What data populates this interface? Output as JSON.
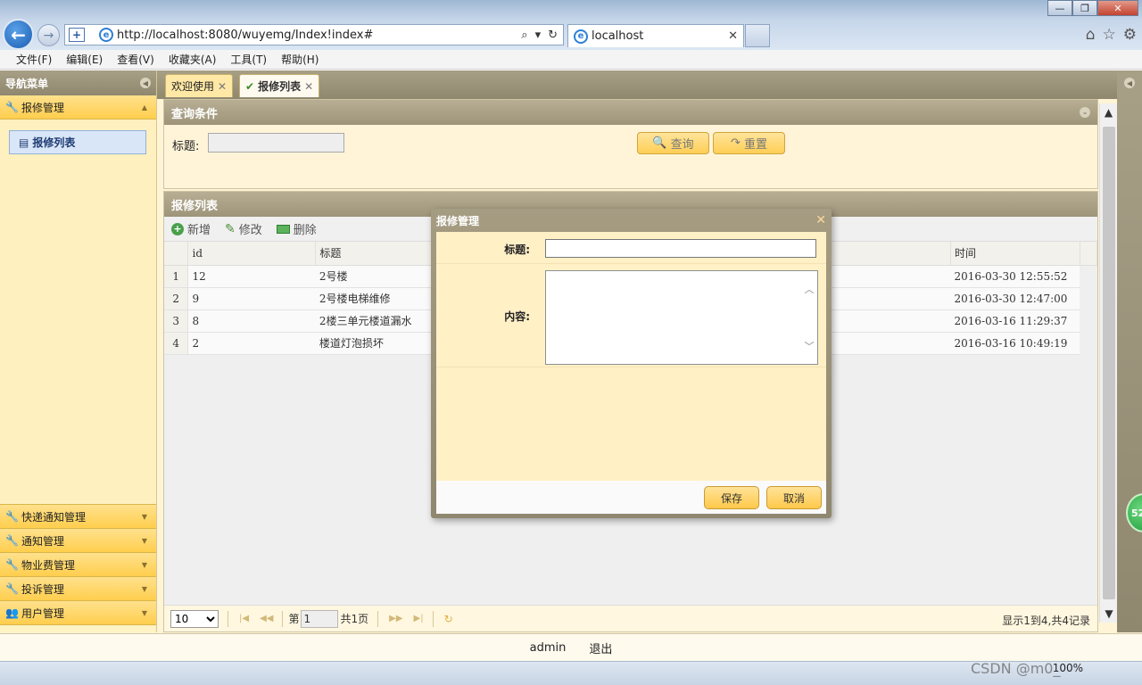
{
  "browser": {
    "url": "http://localhost:8080/wuyemg/Index!index#",
    "tab_title": "localhost",
    "menu": [
      "文件(F)",
      "编辑(E)",
      "查看(V)",
      "收藏夹(A)",
      "工具(T)",
      "帮助(H)"
    ],
    "zoom": "100%"
  },
  "sidebar": {
    "title": "导航菜单",
    "active_group": "报修管理",
    "active_item": "报修列表",
    "groups": [
      "快递通知管理",
      "通知管理",
      "物业费管理",
      "投诉管理",
      "用户管理"
    ]
  },
  "tabs": [
    {
      "label": "欢迎使用"
    },
    {
      "label": "报修列表"
    }
  ],
  "query_panel": {
    "title": "查询条件",
    "title_label": "标题:",
    "search_label": "查询",
    "reset_label": "重置"
  },
  "list_panel": {
    "title": "报修列表",
    "toolbar": {
      "add": "新增",
      "edit": "修改",
      "delete": "删除"
    },
    "columns": {
      "id": "id",
      "title": "标题",
      "time": "时间"
    },
    "rows": [
      {
        "n": "1",
        "id": "12",
        "title": "2号楼",
        "time": "2016-03-30 12:55:52"
      },
      {
        "n": "2",
        "id": "9",
        "title": "2号楼电梯维修",
        "time": "2016-03-30 12:47:00"
      },
      {
        "n": "3",
        "id": "8",
        "title": "2楼三单元楼道漏水",
        "time": "2016-03-16 11:29:37"
      },
      {
        "n": "4",
        "id": "2",
        "title": "楼道灯泡损坏",
        "time": "2016-03-16 10:49:19"
      }
    ],
    "pager": {
      "page_size": "10",
      "page_prefix": "第",
      "page_value": "1",
      "page_suffix": "共1页",
      "info": "显示1到4,共4记录"
    }
  },
  "dialog": {
    "title": "报修管理",
    "title_label": "标题:",
    "content_label": "内容:",
    "save": "保存",
    "cancel": "取消"
  },
  "footer": {
    "user": "admin",
    "logout": "退出"
  },
  "overlay": {
    "watermark": "CSDN @m0_",
    "badge": "52"
  }
}
